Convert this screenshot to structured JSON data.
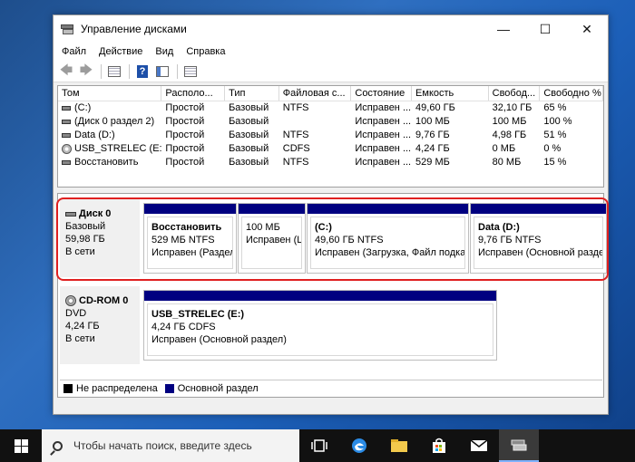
{
  "window": {
    "title": "Управление дисками",
    "controls": {
      "minimize": "—",
      "maximize": "☐",
      "close": "✕"
    }
  },
  "menu": [
    "Файл",
    "Действие",
    "Вид",
    "Справка"
  ],
  "toolbar": {
    "icons": [
      "back-arrow-icon",
      "forward-arrow-icon",
      "properties-icon",
      "help-icon",
      "console-icon",
      "rescan-icon"
    ],
    "back": "🡄",
    "forward": "🡆",
    "help": "?"
  },
  "volume_table": {
    "headers": [
      "Том",
      "Располо...",
      "Тип",
      "Файловая с...",
      "Состояние",
      "Емкость",
      "Свобод...",
      "Свободно %"
    ],
    "rows": [
      [
        "(C:)",
        "Простой",
        "Базовый",
        "NTFS",
        "Исправен ...",
        "49,60 ГБ",
        "32,10 ГБ",
        "65 %"
      ],
      [
        "(Диск 0 раздел 2)",
        "Простой",
        "Базовый",
        "",
        "Исправен ...",
        "100 МБ",
        "100 МБ",
        "100 %"
      ],
      [
        "Data (D:)",
        "Простой",
        "Базовый",
        "NTFS",
        "Исправен ...",
        "9,76 ГБ",
        "4,98 ГБ",
        "51 %"
      ],
      [
        "USB_STRELEC (E:)",
        "Простой",
        "Базовый",
        "CDFS",
        "Исправен ...",
        "4,24 ГБ",
        "0 МБ",
        "0 %"
      ],
      [
        "Восстановить",
        "Простой",
        "Базовый",
        "NTFS",
        "Исправен ...",
        "529 МБ",
        "80 МБ",
        "15 %"
      ]
    ]
  },
  "disk0": {
    "name": "Диск 0",
    "type": "Базовый",
    "size": "59,98 ГБ",
    "status": "В сети",
    "partitions": [
      {
        "name": "Восстановить",
        "size": "529 МБ NTFS",
        "status": "Исправен (Раздел"
      },
      {
        "name": "",
        "size": "100 МБ",
        "status": "Исправен (Ц"
      },
      {
        "name": "(C:)",
        "size": "49,60 ГБ NTFS",
        "status": "Исправен (Загрузка, Файл подкач"
      },
      {
        "name": "Data  (D:)",
        "size": "9,76 ГБ NTFS",
        "status": "Исправен (Основной раздел"
      }
    ]
  },
  "cdrom0": {
    "name": "CD-ROM 0",
    "type": "DVD",
    "size": "4,24 ГБ",
    "status": "В сети",
    "partition": {
      "name": "USB_STRELEC  (E:)",
      "size": "4,24 ГБ CDFS",
      "status": "Исправен (Основной раздел)"
    }
  },
  "legend": [
    {
      "label": "Не распределена",
      "color": "#000000"
    },
    {
      "label": "Основной раздел",
      "color": "#000080"
    }
  ],
  "taskbar": {
    "search_placeholder": "Чтобы начать поиск, введите здесь",
    "apps": [
      "task-view-icon",
      "edge-icon",
      "explorer-icon",
      "store-icon",
      "mail-icon",
      "disk-management-icon"
    ]
  },
  "colors": {
    "primary_partition": "#000080",
    "highlight": "#e02020"
  }
}
